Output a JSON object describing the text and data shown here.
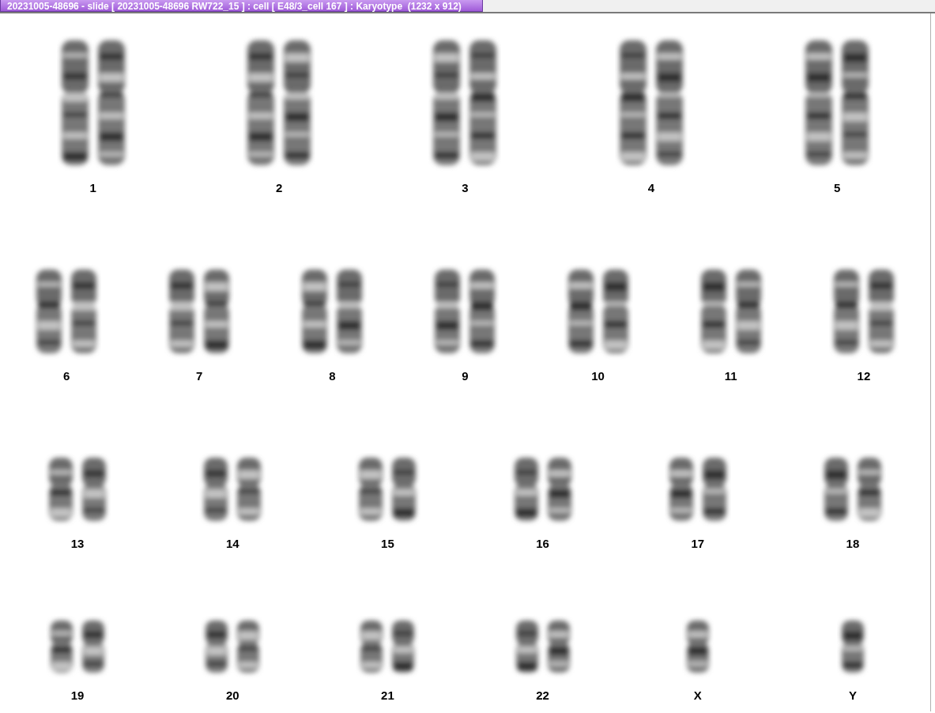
{
  "window": {
    "title": "20231005-48696 - slide [ 20231005-48696 RW722_15 ] : cell [ E48/3_cell 167 ] : Karyotype  (1232 x 912)"
  },
  "karyotype": {
    "rows": [
      {
        "groups": [
          {
            "label": "1",
            "kind": "pair"
          },
          {
            "label": "2",
            "kind": "pair"
          },
          {
            "label": "3",
            "kind": "pair"
          },
          {
            "label": "4",
            "kind": "pair"
          },
          {
            "label": "5",
            "kind": "pair"
          }
        ]
      },
      {
        "groups": [
          {
            "label": "6",
            "kind": "pair"
          },
          {
            "label": "7",
            "kind": "pair"
          },
          {
            "label": "8",
            "kind": "pair"
          },
          {
            "label": "9",
            "kind": "pair"
          },
          {
            "label": "10",
            "kind": "pair"
          },
          {
            "label": "11",
            "kind": "pair"
          },
          {
            "label": "12",
            "kind": "pair"
          }
        ]
      },
      {
        "groups": [
          {
            "label": "13",
            "kind": "pair"
          },
          {
            "label": "14",
            "kind": "pair"
          },
          {
            "label": "15",
            "kind": "pair"
          },
          {
            "label": "16",
            "kind": "pair"
          },
          {
            "label": "17",
            "kind": "pair"
          },
          {
            "label": "18",
            "kind": "pair"
          }
        ]
      },
      {
        "groups": [
          {
            "label": "19",
            "kind": "pair"
          },
          {
            "label": "20",
            "kind": "pair"
          },
          {
            "label": "21",
            "kind": "pair"
          },
          {
            "label": "22",
            "kind": "pair"
          },
          {
            "label": "X",
            "kind": "single"
          },
          {
            "label": "Y",
            "kind": "single"
          }
        ]
      }
    ]
  }
}
